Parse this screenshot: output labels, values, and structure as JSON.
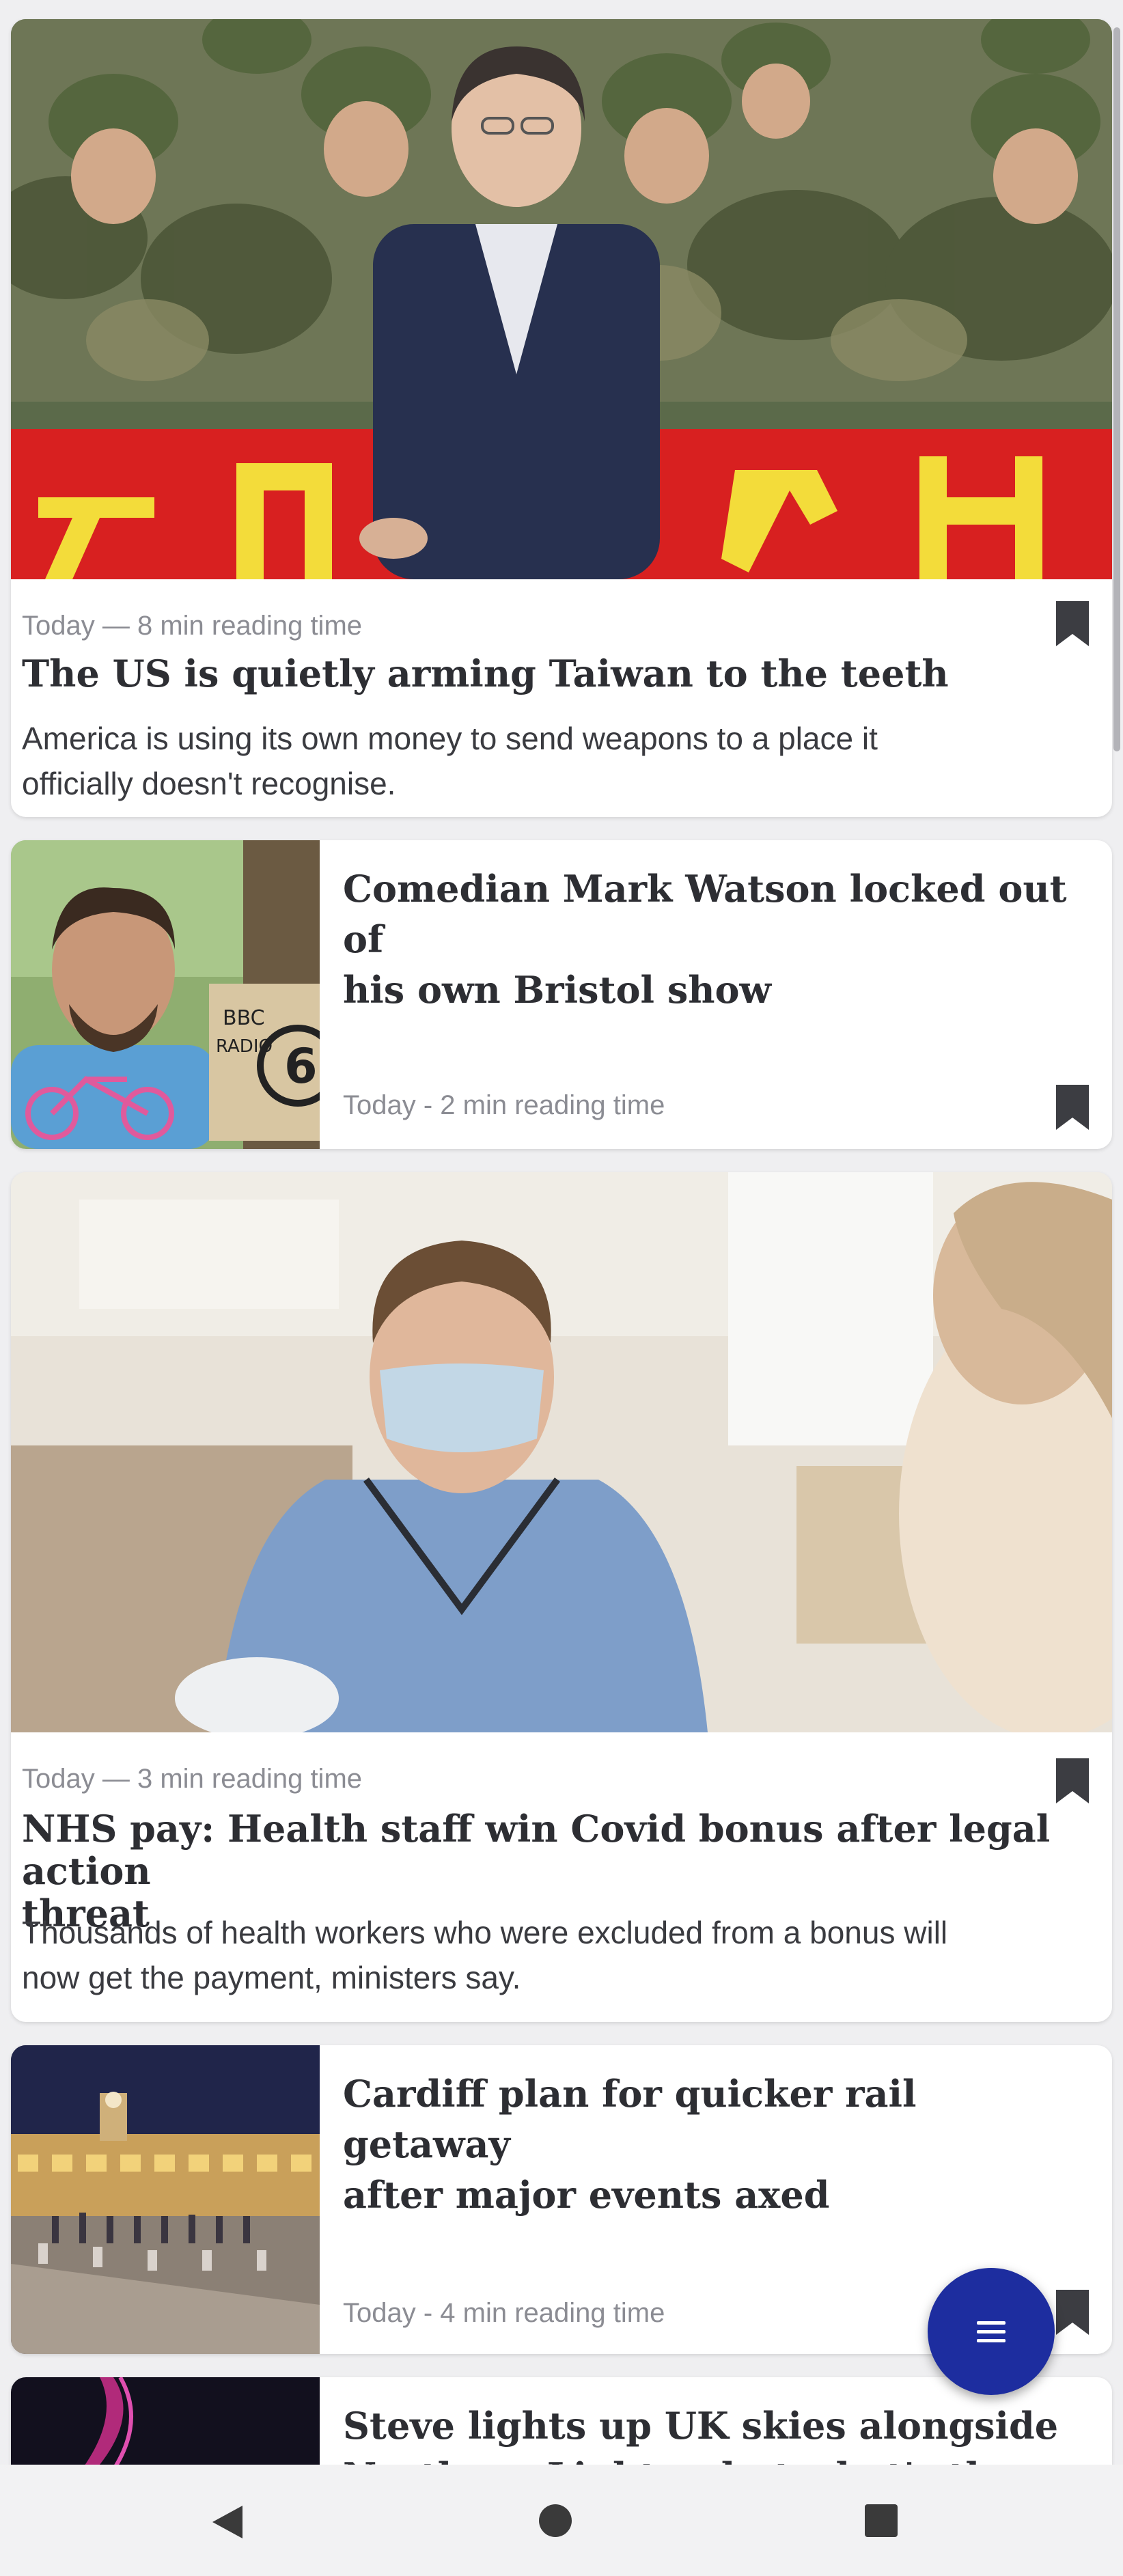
{
  "articles": [
    {
      "meta": "Today — 8 min reading time",
      "title": "The US is quietly arming Taiwan to the teeth",
      "summary_line1": "America is using its own money to send weapons to a place it",
      "summary_line2": "officially doesn't recognise."
    },
    {
      "title_line1": "Comedian Mark Watson locked out of",
      "title_line2": "his own Bristol show",
      "meta": "Today - 2 min reading time",
      "thumb_text1": "BBC",
      "thumb_text2": "RADIO",
      "thumb_text3": "6"
    },
    {
      "meta": "Today — 3 min reading time",
      "title_line1": "NHS pay: Health staff win Covid bonus after legal action",
      "title_line2": "threat",
      "summary_line1": "Thousands of health workers who were excluded from a bonus will",
      "summary_line2": "now get the payment, ministers say."
    },
    {
      "title_line1": "Cardiff plan for quicker rail getaway",
      "title_line2": "after major events axed",
      "meta": "Today - 4 min reading time"
    },
    {
      "title_line1": "Steve lights up UK skies alongside",
      "title_line2": "Northern Lights – but what's the diff..."
    }
  ],
  "icons": {
    "bookmark": "bookmark-icon",
    "menu": "menu-icon",
    "back": "back-icon",
    "home": "home-icon",
    "recents": "recents-icon"
  },
  "colors": {
    "fab": "#1d2d9f",
    "background": "#efeff1"
  }
}
